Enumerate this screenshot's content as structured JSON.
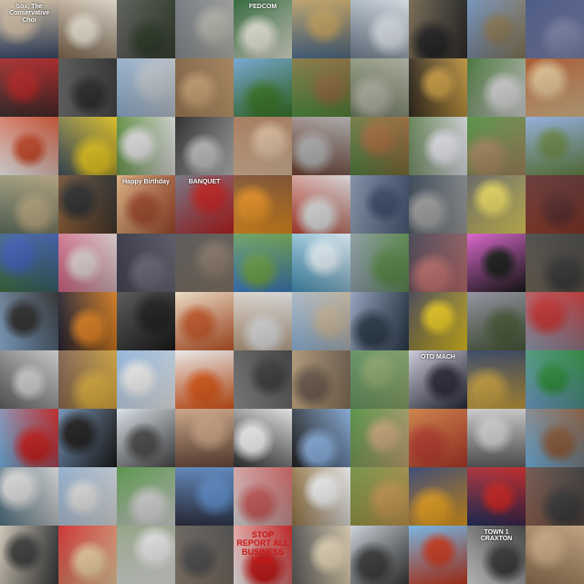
{
  "mosaic": {
    "rows": 10,
    "cols": 10,
    "tiles": [
      {
        "c": "#3a4a6a",
        "d": "#c9b8a0",
        "t": "Sox, The Conservative Choi"
      },
      {
        "c": "#7a6048",
        "d": "#e8e0d0"
      },
      {
        "c": "#5a5a58",
        "d": "#2e3a28"
      },
      {
        "c": "#6a7078",
        "d": "#b8b8b0"
      },
      {
        "c": "#1e5a2a",
        "d": "#e8e8d8",
        "t": "FEDCOM"
      },
      {
        "c": "#4a6a8a",
        "d": "#c0a060"
      },
      {
        "c": "#6a7a8a",
        "d": "#dfe6ee"
      },
      {
        "c": "#7a6a50",
        "d": "#222222"
      },
      {
        "c": "#6a8ab8",
        "d": "#8a7a58"
      },
      {
        "c": "#3a4a7a",
        "d": "#8088b0"
      },
      {
        "c": "#3a2a2a",
        "d": "#b02020"
      },
      {
        "c": "#6a6a6a",
        "d": "#2a2a2a"
      },
      {
        "c": "#8aa8c8",
        "d": "#c0c8d0"
      },
      {
        "c": "#7a5a3a",
        "d": "#c8a070"
      },
      {
        "c": "#6aa0d0",
        "d": "#3a7a2a"
      },
      {
        "c": "#4a8a3a",
        "d": "#8a6a3a"
      },
      {
        "c": "#6a7a5a",
        "d": "#b0b0a0"
      },
      {
        "c": "#2a2218",
        "d": "#c89a40"
      },
      {
        "c": "#3a6a2a",
        "d": "#d8d8d8"
      },
      {
        "c": "#a04a20",
        "d": "#e0c090"
      },
      {
        "c": "#f0f0f0",
        "d": "#c84a2a"
      },
      {
        "c": "#3a4a5a",
        "d": "#e8c820"
      },
      {
        "c": "#5a8a3a",
        "d": "#e0e0e0"
      },
      {
        "c": "#1a1a1a",
        "d": "#c0c0c0"
      },
      {
        "c": "#a07050",
        "d": "#e0c0a0"
      },
      {
        "c": "#6a3a2a",
        "d": "#b0b0b0"
      },
      {
        "c": "#4a7a3a",
        "d": "#a06a3a"
      },
      {
        "c": "#5a7a4a",
        "d": "#e8e8f0"
      },
      {
        "c": "#4a8a3a",
        "d": "#a88a60"
      },
      {
        "c": "#8aa8d8",
        "d": "#6a8a4a"
      },
      {
        "c": "#5a6a5a",
        "d": "#b8a880"
      },
      {
        "c": "#8a5a30",
        "d": "#2a2a2a"
      },
      {
        "c": "#d8a878",
        "d": "#a04a2a",
        "t": "Happy Birthday"
      },
      {
        "c": "#6a6a7a",
        "d": "#c02020",
        "t": "BANQUET"
      },
      {
        "c": "#7a4a2a",
        "d": "#e89020"
      },
      {
        "c": "#b83a2a",
        "d": "#e0e0e0"
      },
      {
        "c": "#8a9ab0",
        "d": "#3a4a6a"
      },
      {
        "c": "#2a3a4a",
        "d": "#a0a0a0"
      },
      {
        "c": "#5a5a5a",
        "d": "#e8d860"
      },
      {
        "c": "#8a3a2a",
        "d": "#5a2a2a"
      },
      {
        "c": "#3a6a3a",
        "d": "#3a5ab0"
      },
      {
        "c": "#c85a7a",
        "d": "#e0d0d0"
      },
      {
        "c": "#2a2a3a",
        "d": "#6a6a7a"
      },
      {
        "c": "#4a4a4a",
        "d": "#8a7a6a"
      },
      {
        "c": "#3a7ac8",
        "d": "#6aa04a"
      },
      {
        "c": "#3a8ab0",
        "d": "#e0f0f8"
      },
      {
        "c": "#8a9aa8",
        "d": "#5a8a4a"
      },
      {
        "c": "#3a3a4a",
        "d": "#c07070"
      },
      {
        "c": "#d858c8",
        "d": "#1a1a1a"
      },
      {
        "c": "#6a6050",
        "d": "#3a3a3a"
      },
      {
        "c": "#8ab0d8",
        "d": "#2a2a2a"
      },
      {
        "c": "#1a1a2a",
        "d": "#e08020"
      },
      {
        "c": "#4a4a4a",
        "d": "#1a1a1a"
      },
      {
        "c": "#e8d8c0",
        "d": "#c85a2a"
      },
      {
        "c": "#b89a7a",
        "d": "#e0e0e0"
      },
      {
        "c": "#8ab0d8",
        "d": "#c8b8a0"
      },
      {
        "c": "#8a9ab8",
        "d": "#2a3a4a"
      },
      {
        "c": "#3a3a4a",
        "d": "#e8c820"
      },
      {
        "c": "#8a8a9a",
        "d": "#4a5a3a"
      },
      {
        "c": "#8a9ab0",
        "d": "#c03030"
      },
      {
        "c": "#5a5a5a",
        "d": "#d0d0d0"
      },
      {
        "c": "#7a5a4a",
        "d": "#e0b040"
      },
      {
        "c": "#8ab0d8",
        "d": "#f0f0f0"
      },
      {
        "c": "#e8e8e8",
        "d": "#e05a1a"
      },
      {
        "c": "#8a8a8a",
        "d": "#3a3a3a"
      },
      {
        "c": "#c8a880",
        "d": "#6a5a4a"
      },
      {
        "c": "#5a8a5a",
        "d": "#8aa86a"
      },
      {
        "c": "#c8c8d8",
        "d": "#2a2a3a",
        "t": "OTO MACH"
      },
      {
        "c": "#2a3a5a",
        "d": "#c8a040"
      },
      {
        "c": "#6a9ac8",
        "d": "#2a8a3a"
      },
      {
        "c": "#6ab0e0",
        "d": "#c82020"
      },
      {
        "c": "#6a8ab0",
        "d": "#1a1a1a"
      },
      {
        "c": "#d8e0e8",
        "d": "#4a4a4a"
      },
      {
        "c": "#6a4a3a",
        "d": "#c8a080"
      },
      {
        "c": "#2a2a2a",
        "d": "#f0f0f0"
      },
      {
        "c": "#1a1a1a",
        "d": "#8ab0e0"
      },
      {
        "c": "#4a8a3a",
        "d": "#c8a878"
      },
      {
        "c": "#c8783a",
        "d": "#b83a2a"
      },
      {
        "c": "#5a5a5a",
        "d": "#d0d0d0"
      },
      {
        "c": "#6ab0e0",
        "d": "#8a5a3a"
      },
      {
        "c": "#4a6a7a",
        "d": "#d8d8d8"
      },
      {
        "c": "#8aa8c8",
        "d": "#e0e0e0"
      },
      {
        "c": "#4a8a3a",
        "d": "#d8d8d8"
      },
      {
        "c": "#2a2a3a",
        "d": "#5a8ac8"
      },
      {
        "c": "#d8d8d8",
        "d": "#c85a5a"
      },
      {
        "c": "#8a6a3a",
        "d": "#f0f0f0"
      },
      {
        "c": "#6a8a3a",
        "d": "#c89a50"
      },
      {
        "c": "#2a3a6a",
        "d": "#e8a020"
      },
      {
        "c": "#1a2a5a",
        "d": "#c82020"
      },
      {
        "c": "#8a5a4a",
        "d": "#3a3a3a"
      },
      {
        "c": "#c8c0b0",
        "d": "#3a3a3a"
      },
      {
        "c": "#c82020",
        "d": "#f0d0a0"
      },
      {
        "c": "#8a9a7a",
        "d": "#e8e8e8"
      },
      {
        "c": "#8a7a6a",
        "d": "#4a4a4a"
      },
      {
        "c": "#f0f0f0",
        "d": "#c81818",
        "t": "STOP REPORT ALL BUSINESS HERE"
      },
      {
        "c": "#4a4a4a",
        "d": "#e8d8b8"
      },
      {
        "c": "#c8d0d8",
        "d": "#3a3a3a"
      },
      {
        "c": "#6ab0e0",
        "d": "#c83a20"
      },
      {
        "c": "#d8d8d8",
        "d": "#3a3a3a",
        "t": "TOWN 1 CRAXTON"
      },
      {
        "c": "#8a6a4a",
        "d": "#c8a880"
      }
    ]
  }
}
